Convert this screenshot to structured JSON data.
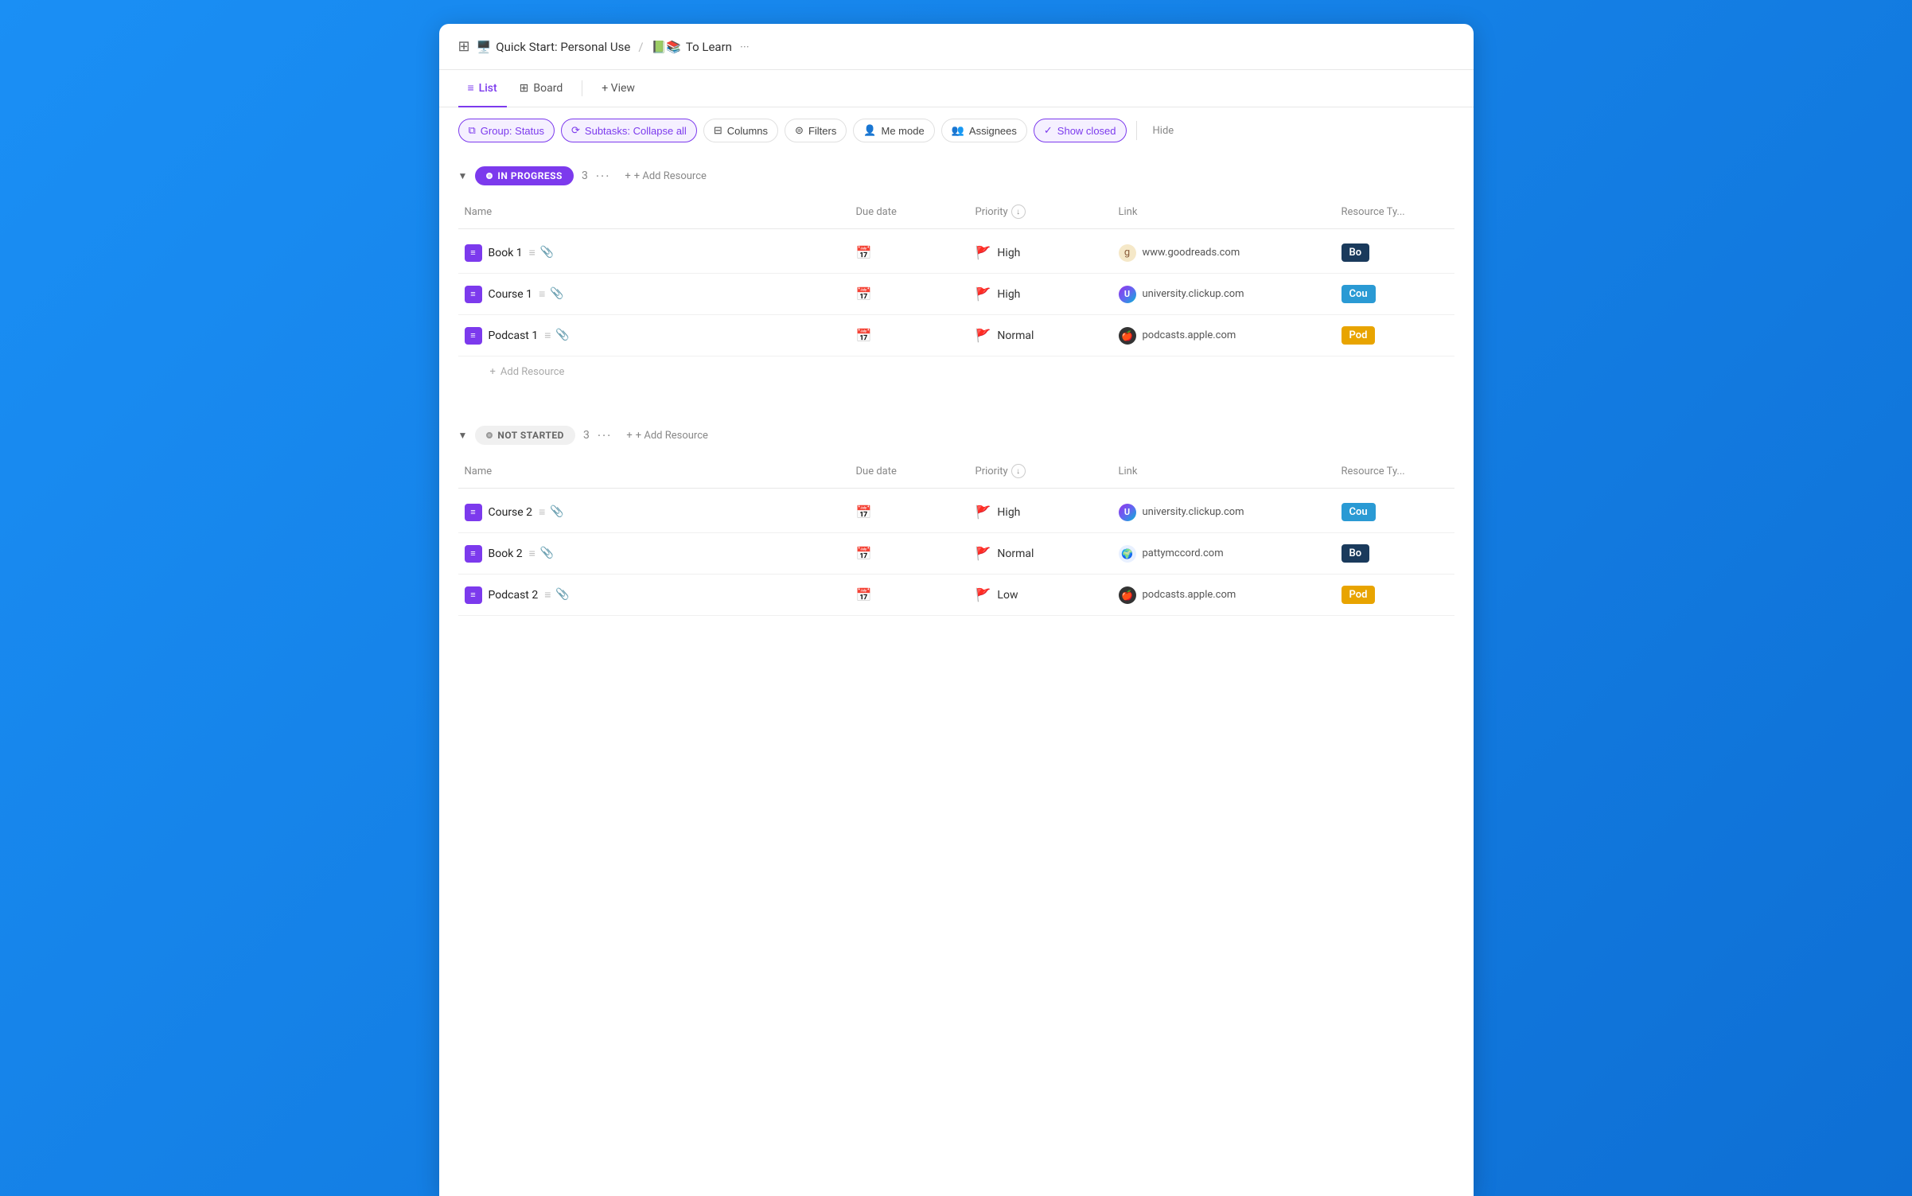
{
  "titlebar": {
    "toggle_icon": "⊞",
    "breadcrumb1_emoji": "🖥️",
    "breadcrumb1_label": "Quick Start: Personal Use",
    "separator": "/",
    "breadcrumb2_emoji": "📗📚",
    "breadcrumb2_label": "To Learn",
    "more_icon": "···"
  },
  "view_tabs": [
    {
      "id": "list",
      "label": "List",
      "icon": "≡",
      "active": true
    },
    {
      "id": "board",
      "label": "Board",
      "icon": "⊞",
      "active": false
    }
  ],
  "view_add": "+ View",
  "toolbar": {
    "group_status": "Group: Status",
    "subtasks": "Subtasks: Collapse all",
    "columns": "Columns",
    "filters": "Filters",
    "me_mode": "Me mode",
    "assignees": "Assignees",
    "show_closed": "Show closed",
    "hide": "Hide"
  },
  "sections": [
    {
      "id": "in-progress",
      "status": "IN PROGRESS",
      "status_type": "in-progress",
      "count": 3,
      "items": [
        {
          "name": "Book 1",
          "due_date": "",
          "priority": "High",
          "priority_level": "high",
          "link_icon": "g",
          "link_icon_class": "link-goodreads",
          "link_url": "www.goodreads.com",
          "resource_type": "Bo",
          "resource_class": "rt-book"
        },
        {
          "name": "Course 1",
          "due_date": "",
          "priority": "High",
          "priority_level": "high",
          "link_icon": "U",
          "link_icon_class": "link-clickup",
          "link_url": "university.clickup.com",
          "resource_type": "Cou",
          "resource_class": "rt-course"
        },
        {
          "name": "Podcast 1",
          "due_date": "",
          "priority": "Normal",
          "priority_level": "normal",
          "link_icon": "🍎",
          "link_icon_class": "link-apple",
          "link_url": "podcasts.apple.com",
          "resource_type": "Pod",
          "resource_class": "rt-podcast"
        }
      ]
    },
    {
      "id": "not-started",
      "status": "NOT STARTED",
      "status_type": "not-started",
      "count": 3,
      "items": [
        {
          "name": "Course 2",
          "due_date": "",
          "priority": "High",
          "priority_level": "high",
          "link_icon": "U",
          "link_icon_class": "link-clickup",
          "link_url": "university.clickup.com",
          "resource_type": "Cou",
          "resource_class": "rt-course"
        },
        {
          "name": "Book 2",
          "due_date": "",
          "priority": "Normal",
          "priority_level": "normal",
          "link_icon": "🌍",
          "link_icon_class": "link-patty",
          "link_url": "pattymccord.com",
          "resource_type": "Bo",
          "resource_class": "rt-book"
        },
        {
          "name": "Podcast 2",
          "due_date": "",
          "priority": "Low",
          "priority_level": "low",
          "link_icon": "🍎",
          "link_icon_class": "link-apple",
          "link_url": "podcasts.apple.com",
          "resource_type": "Pod",
          "resource_class": "rt-podcast"
        }
      ]
    }
  ],
  "columns": {
    "name": "Name",
    "due_date": "Due date",
    "priority": "Priority",
    "link": "Link",
    "resource_type": "Resource Ty..."
  },
  "add_resource_label": "+ Add Resource"
}
